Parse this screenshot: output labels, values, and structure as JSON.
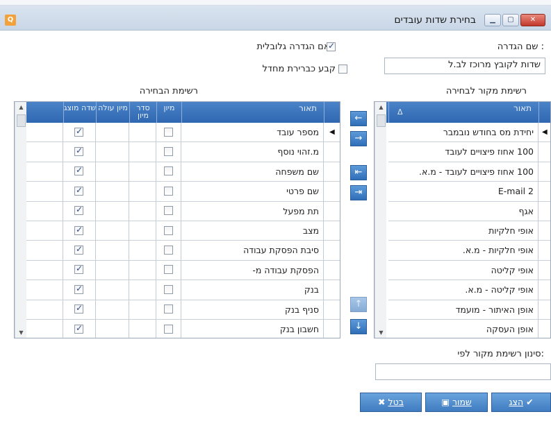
{
  "window": {
    "title": "בחירת שדות עובדים",
    "app_icon": "app-logo-icon",
    "controls": {
      "close": "✕",
      "maximize": "▭",
      "minimize": "▭"
    }
  },
  "form": {
    "setting_name_label": "שם הגדרה :",
    "setting_name_value": "שדות לקובץ מרוכז לב.ל",
    "global_label": "האם הגדרה גלובלית",
    "global_checked": true,
    "default_label": "קבע כברירת מחדל",
    "default_checked": false
  },
  "source_list": {
    "title": "רשימת מקור לבחירה",
    "col_desc": "תאור",
    "sort_glyph": "Δ",
    "rows": [
      "יחידת מס בחודש נובמבר",
      "100 אחוז פיצויים לעובד",
      "100 אחוז פיצויים לעובד - מ.א.",
      "E-mail 2",
      "אגף",
      "אופי חלקיות",
      "אופי חלקיות - מ.א.",
      "אופי קליטה",
      "אופי קליטה - מ.א.",
      "אופן האיתור - מועמד",
      "אופן העסקה"
    ]
  },
  "selected_list": {
    "title": "רשימת הבחירה",
    "col_desc": "תאור",
    "col_sort": "מיון",
    "col_sort_order": "סדר מיון",
    "col_sort_asc": "מיון עולה",
    "col_display": "שדה מוצג",
    "rows": [
      {
        "desc": "מספר עובד",
        "sort": false,
        "display": true
      },
      {
        "desc": "מ.זהוי נוסף",
        "sort": false,
        "display": true
      },
      {
        "desc": "שם משפחה",
        "sort": false,
        "display": true
      },
      {
        "desc": "שם פרטי",
        "sort": false,
        "display": true
      },
      {
        "desc": "תת מפעל",
        "sort": false,
        "display": true
      },
      {
        "desc": "מצב",
        "sort": false,
        "display": true
      },
      {
        "desc": "סיבת הפסקת עבודה",
        "sort": false,
        "display": true
      },
      {
        "desc": "הפסקת עבודה מ-",
        "sort": false,
        "display": true
      },
      {
        "desc": "בנק",
        "sort": false,
        "display": true
      },
      {
        "desc": "סניף בנק",
        "sort": false,
        "display": true
      },
      {
        "desc": "חשבון בנק",
        "sort": false,
        "display": true
      }
    ]
  },
  "move_buttons": {
    "add": "←",
    "remove": "→",
    "add_all": "⇤",
    "remove_all": "⇥",
    "up": "↑",
    "down": "↓"
  },
  "filter": {
    "label": "סינון רשימת מקור לפי:",
    "value": ""
  },
  "actions": {
    "show": "הצג",
    "save": "שמור",
    "cancel": "בטל"
  }
}
